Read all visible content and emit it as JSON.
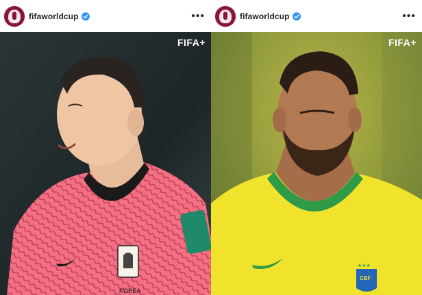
{
  "posts": [
    {
      "username": "fifaworldcup",
      "watermark": "FIFA+",
      "jersey_text": "KOREA",
      "colors": {
        "jersey": "#f26a7e",
        "background": "#1f2a2c"
      }
    },
    {
      "username": "fifaworldcup",
      "watermark": "FIFA+",
      "jersey_text": "CBF",
      "colors": {
        "jersey": "#f1e32b",
        "background": "#c9c24b"
      }
    }
  ],
  "icons": {
    "verified": "verified-badge-icon",
    "more": "more-options-icon",
    "avatar": "fifa-world-cup-avatar"
  },
  "colors": {
    "verified": "#3897f0",
    "avatar_bg": "#8a1538"
  }
}
